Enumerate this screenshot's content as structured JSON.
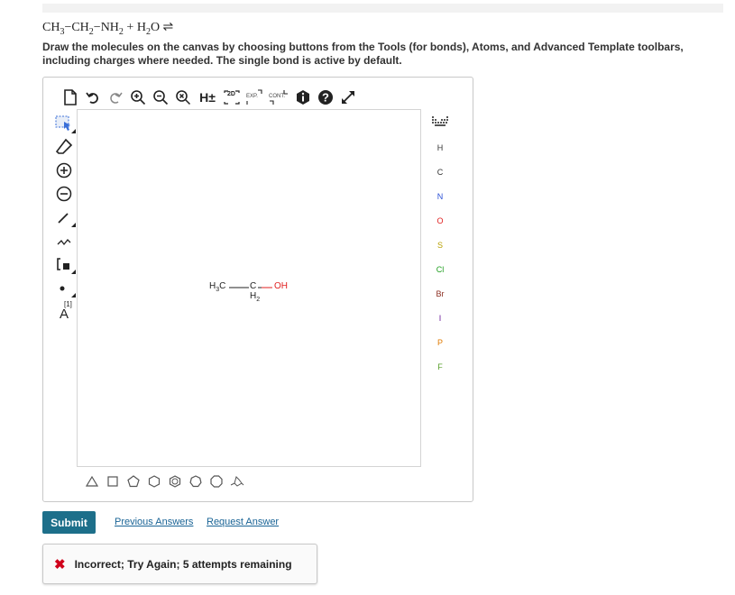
{
  "question": {
    "equation_html": "CH<sub>3</sub>&minus;CH<sub>2</sub>&minus;NH<sub>2</sub> + H<sub>2</sub>O &#8652;",
    "instructions": "Draw the molecules on the canvas by choosing buttons from the Tools (for bonds), Atoms, and Advanced Template toolbars, including charges where needed. The single bond is active by default."
  },
  "toolbar_top": [
    {
      "name": "new-document-icon",
      "label": ""
    },
    {
      "name": "undo-icon",
      "label": ""
    },
    {
      "name": "redo-icon",
      "label": ""
    },
    {
      "name": "zoom-in-icon",
      "label": ""
    },
    {
      "name": "zoom-out-icon",
      "label": ""
    },
    {
      "name": "zoom-reset-icon",
      "label": ""
    },
    {
      "name": "explicit-hydrogens-button",
      "label": "H±"
    },
    {
      "name": "2d-clean-button",
      "label": "2D"
    },
    {
      "name": "expand-button",
      "label": "EXP."
    },
    {
      "name": "contract-button",
      "label": "CONT."
    },
    {
      "name": "info-icon",
      "label": ""
    },
    {
      "name": "help-icon",
      "label": ""
    },
    {
      "name": "fullscreen-icon",
      "label": ""
    }
  ],
  "atoms": [
    "H",
    "C",
    "N",
    "O",
    "S",
    "Cl",
    "Br",
    "I",
    "P",
    "F"
  ],
  "atom_colors": {
    "H": "#333333",
    "C": "#333333",
    "N": "#2a4fd6",
    "O": "#e02020",
    "S": "#b8a000",
    "Cl": "#1e9e1e",
    "Br": "#8a2b1e",
    "I": "#6a1b9a",
    "P": "#e07a00",
    "F": "#5aa02c"
  },
  "periodic_table_label": "periodic-table",
  "isotope_label": "A",
  "isotope_sup": "[1]",
  "molecule": {
    "left_group": "H",
    "left_sub": "3",
    "left_c": "C",
    "center_atom": "C",
    "center_h": "H",
    "center_sub": "2",
    "right_group": "OH"
  },
  "actions": {
    "submit": "Submit",
    "previous_answers": "Previous Answers",
    "request_answer": "Request Answer"
  },
  "feedback": {
    "icon": "✖",
    "message": "Incorrect; Try Again; 5 attempts remaining"
  }
}
